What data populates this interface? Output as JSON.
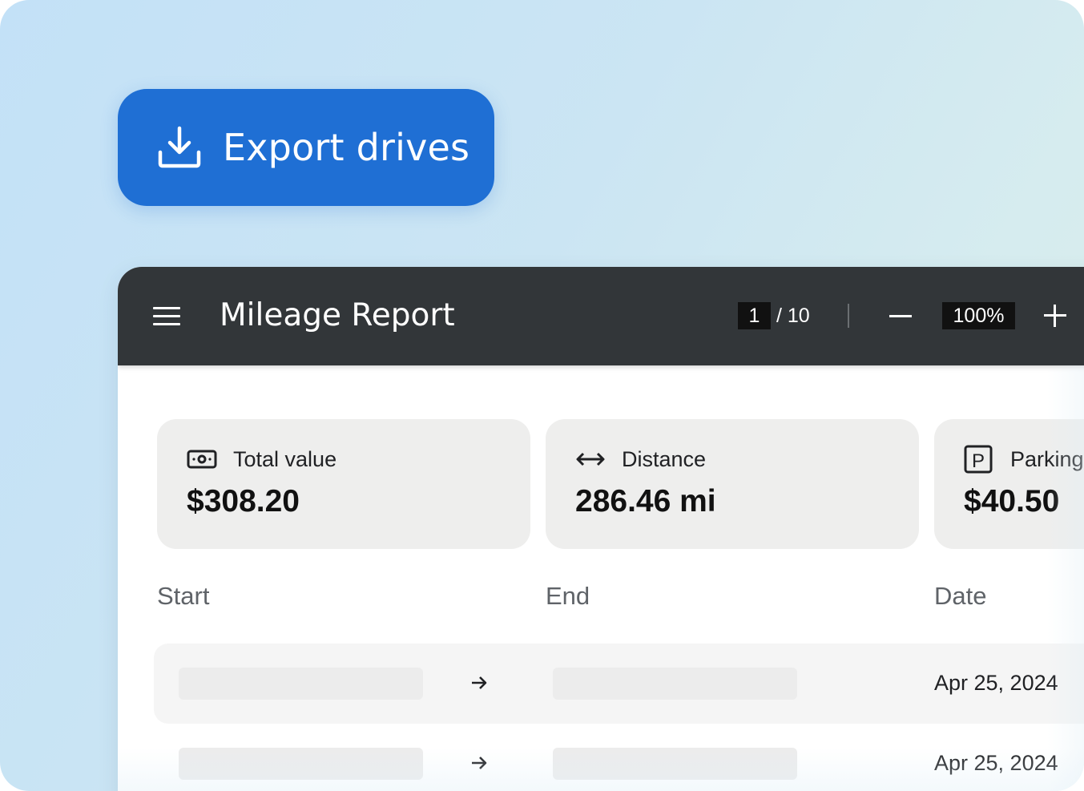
{
  "export_button": {
    "label": "Export drives",
    "icon": "download-icon"
  },
  "viewer": {
    "title": "Mileage Report",
    "menu_icon": "hamburger-menu-icon",
    "page_current": "1",
    "page_total": "/ 10",
    "zoom": "100%"
  },
  "summary_cards": [
    {
      "icon": "cash-icon",
      "label": "Total value",
      "value": "$308.20"
    },
    {
      "icon": "distance-arrows-icon",
      "label": "Distance",
      "value": "286.46 mi"
    },
    {
      "icon": "parking-icon",
      "label": "Parking",
      "value": "$40.50"
    }
  ],
  "table": {
    "columns": [
      "Start",
      "End",
      "Date"
    ],
    "rows": [
      {
        "date": "Apr 25, 2024"
      },
      {
        "date": "Apr 25, 2024"
      }
    ]
  },
  "colors": {
    "accent": "#1f6fd4",
    "toolbar": "#323639",
    "card_bg": "#eeeeed"
  }
}
